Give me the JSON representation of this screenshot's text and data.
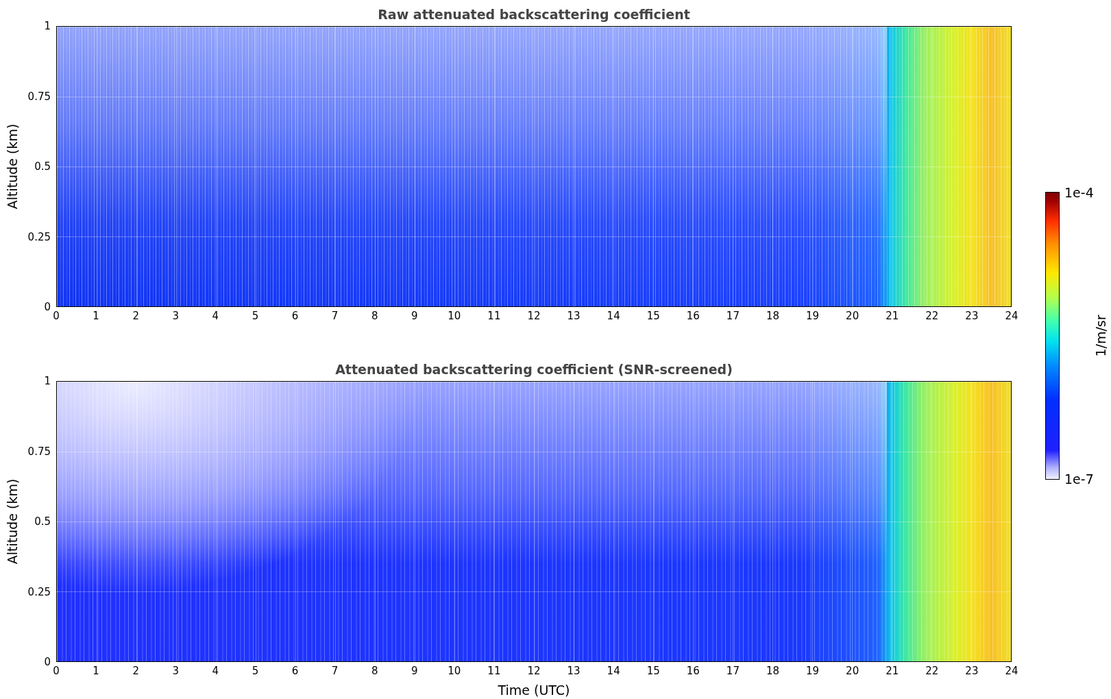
{
  "panels": [
    {
      "kind": "raw",
      "title": "Raw attenuated backscattering coefficient",
      "ylabel": "Altitude (km)",
      "yticks": [
        "1",
        "0.75",
        "0.5",
        "0.25",
        "0"
      ],
      "xticks": [
        "0",
        "1",
        "2",
        "3",
        "4",
        "5",
        "6",
        "7",
        "8",
        "9",
        "10",
        "11",
        "12",
        "13",
        "14",
        "15",
        "16",
        "17",
        "18",
        "19",
        "20",
        "21",
        "22",
        "23",
        "24"
      ]
    },
    {
      "kind": "screened",
      "title": "Attenuated backscattering coefficient (SNR-screened)",
      "ylabel": "Altitude (km)",
      "yticks": [
        "1",
        "0.75",
        "0.5",
        "0.25",
        "0"
      ],
      "xticks": [
        "0",
        "1",
        "2",
        "3",
        "4",
        "5",
        "6",
        "7",
        "8",
        "9",
        "10",
        "11",
        "12",
        "13",
        "14",
        "15",
        "16",
        "17",
        "18",
        "19",
        "20",
        "21",
        "22",
        "23",
        "24"
      ],
      "xlabel": "Time (UTC)"
    }
  ],
  "colorbar": {
    "max": "1e-4",
    "min": "1e-7",
    "label": "1/m/sr"
  }
}
